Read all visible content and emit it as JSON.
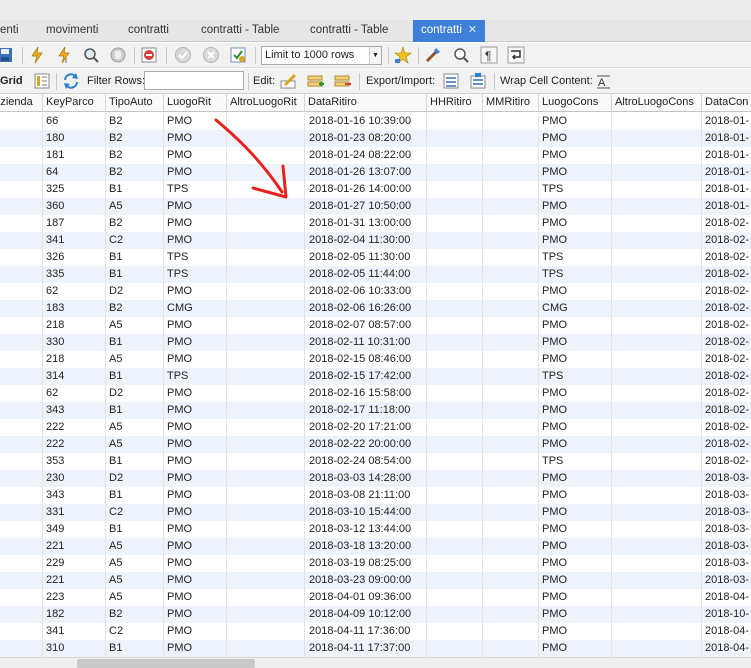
{
  "tabs": [
    {
      "label": "enti",
      "active": false
    },
    {
      "label": "movimenti",
      "active": false
    },
    {
      "label": "contratti",
      "active": false
    },
    {
      "label": "contratti - Table",
      "active": false
    },
    {
      "label": "contratti - Table",
      "active": false
    },
    {
      "label": "contratti",
      "active": true
    }
  ],
  "toolbar1": {
    "limit_select_value": "Limit to 1000 rows"
  },
  "toolbar2": {
    "grid_label": "Grid",
    "filter_label": "Filter Rows:",
    "filter_value": "",
    "edit_label": "Edit:",
    "export_label": "Export/Import:",
    "wrap_label": "Wrap Cell Content:"
  },
  "grid": {
    "columns": [
      "Azienda",
      "KeyParco",
      "TipoAuto",
      "LuogoRit",
      "AltroLuogoRit",
      "DataRitiro",
      "HHRitiro",
      "MMRitiro",
      "LuogoCons",
      "AltroLuogoCons",
      "DataCon"
    ],
    "rows": [
      [
        "",
        "66",
        "B2",
        "PMO",
        "",
        "2018-01-16 10:39:00",
        "",
        "",
        "PMO",
        "",
        "2018-01-"
      ],
      [
        "",
        "180",
        "B2",
        "PMO",
        "",
        "2018-01-23 08:20:00",
        "",
        "",
        "PMO",
        "",
        "2018-01-"
      ],
      [
        "",
        "181",
        "B2",
        "PMO",
        "",
        "2018-01-24 08:22:00",
        "",
        "",
        "PMO",
        "",
        "2018-01-"
      ],
      [
        "",
        "64",
        "B2",
        "PMO",
        "",
        "2018-01-26 13:07:00",
        "",
        "",
        "PMO",
        "",
        "2018-01-"
      ],
      [
        "",
        "325",
        "B1",
        "TPS",
        "",
        "2018-01-26 14:00:00",
        "",
        "",
        "TPS",
        "",
        "2018-01-"
      ],
      [
        "",
        "360",
        "A5",
        "PMO",
        "",
        "2018-01-27 10:50:00",
        "",
        "",
        "PMO",
        "",
        "2018-01-"
      ],
      [
        "",
        "187",
        "B2",
        "PMO",
        "",
        "2018-01-31 13:00:00",
        "",
        "",
        "PMO",
        "",
        "2018-02-"
      ],
      [
        "",
        "341",
        "C2",
        "PMO",
        "",
        "2018-02-04 11:30:00",
        "",
        "",
        "PMO",
        "",
        "2018-02-"
      ],
      [
        "",
        "326",
        "B1",
        "TPS",
        "",
        "2018-02-05 11:30:00",
        "",
        "",
        "TPS",
        "",
        "2018-02-"
      ],
      [
        "",
        "335",
        "B1",
        "TPS",
        "",
        "2018-02-05 11:44:00",
        "",
        "",
        "TPS",
        "",
        "2018-02-"
      ],
      [
        "",
        "62",
        "D2",
        "PMO",
        "",
        "2018-02-06 10:33:00",
        "",
        "",
        "PMO",
        "",
        "2018-02-"
      ],
      [
        "",
        "183",
        "B2",
        "CMG",
        "",
        "2018-02-06 16:26:00",
        "",
        "",
        "CMG",
        "",
        "2018-02-"
      ],
      [
        "",
        "218",
        "A5",
        "PMO",
        "",
        "2018-02-07 08:57:00",
        "",
        "",
        "PMO",
        "",
        "2018-02-"
      ],
      [
        "",
        "330",
        "B1",
        "PMO",
        "",
        "2018-02-11 10:31:00",
        "",
        "",
        "PMO",
        "",
        "2018-02-"
      ],
      [
        "",
        "218",
        "A5",
        "PMO",
        "",
        "2018-02-15 08:46:00",
        "",
        "",
        "PMO",
        "",
        "2018-02-"
      ],
      [
        "",
        "314",
        "B1",
        "TPS",
        "",
        "2018-02-15 17:42:00",
        "",
        "",
        "TPS",
        "",
        "2018-02-"
      ],
      [
        "",
        "62",
        "D2",
        "PMO",
        "",
        "2018-02-16 15:58:00",
        "",
        "",
        "PMO",
        "",
        "2018-02-"
      ],
      [
        "",
        "343",
        "B1",
        "PMO",
        "",
        "2018-02-17 11:18:00",
        "",
        "",
        "PMO",
        "",
        "2018-02-"
      ],
      [
        "",
        "222",
        "A5",
        "PMO",
        "",
        "2018-02-20 17:21:00",
        "",
        "",
        "PMO",
        "",
        "2018-02-"
      ],
      [
        "",
        "222",
        "A5",
        "PMO",
        "",
        "2018-02-22 20:00:00",
        "",
        "",
        "PMO",
        "",
        "2018-02-"
      ],
      [
        "",
        "353",
        "B1",
        "PMO",
        "",
        "2018-02-24 08:54:00",
        "",
        "",
        "TPS",
        "",
        "2018-02-"
      ],
      [
        "",
        "230",
        "D2",
        "PMO",
        "",
        "2018-03-03 14:28:00",
        "",
        "",
        "PMO",
        "",
        "2018-03-"
      ],
      [
        "",
        "343",
        "B1",
        "PMO",
        "",
        "2018-03-08 21:11:00",
        "",
        "",
        "PMO",
        "",
        "2018-03-"
      ],
      [
        "",
        "331",
        "C2",
        "PMO",
        "",
        "2018-03-10 15:44:00",
        "",
        "",
        "PMO",
        "",
        "2018-03-"
      ],
      [
        "",
        "349",
        "B1",
        "PMO",
        "",
        "2018-03-12 13:44:00",
        "",
        "",
        "PMO",
        "",
        "2018-03-"
      ],
      [
        "",
        "221",
        "A5",
        "PMO",
        "",
        "2018-03-18 13:20:00",
        "",
        "",
        "PMO",
        "",
        "2018-03-"
      ],
      [
        "",
        "229",
        "A5",
        "PMO",
        "",
        "2018-03-19 08:25:00",
        "",
        "",
        "PMO",
        "",
        "2018-03-"
      ],
      [
        "",
        "221",
        "A5",
        "PMO",
        "",
        "2018-03-23 09:00:00",
        "",
        "",
        "PMO",
        "",
        "2018-03-"
      ],
      [
        "",
        "223",
        "A5",
        "PMO",
        "",
        "2018-04-01 09:36:00",
        "",
        "",
        "PMO",
        "",
        "2018-04-"
      ],
      [
        "",
        "182",
        "B2",
        "PMO",
        "",
        "2018-04-09 10:12:00",
        "",
        "",
        "PMO",
        "",
        "2018-10-"
      ],
      [
        "",
        "341",
        "C2",
        "PMO",
        "",
        "2018-04-11 17:36:00",
        "",
        "",
        "PMO",
        "",
        "2018-04-"
      ],
      [
        "",
        "310",
        "B1",
        "PMO",
        "",
        "2018-04-11 17:37:00",
        "",
        "",
        "PMO",
        "",
        "2018-04-"
      ]
    ]
  },
  "colors": {
    "active_tab": "#3d7fd9",
    "row_alt": "#eef3fb",
    "annotation_arrow": "#e8221f"
  }
}
